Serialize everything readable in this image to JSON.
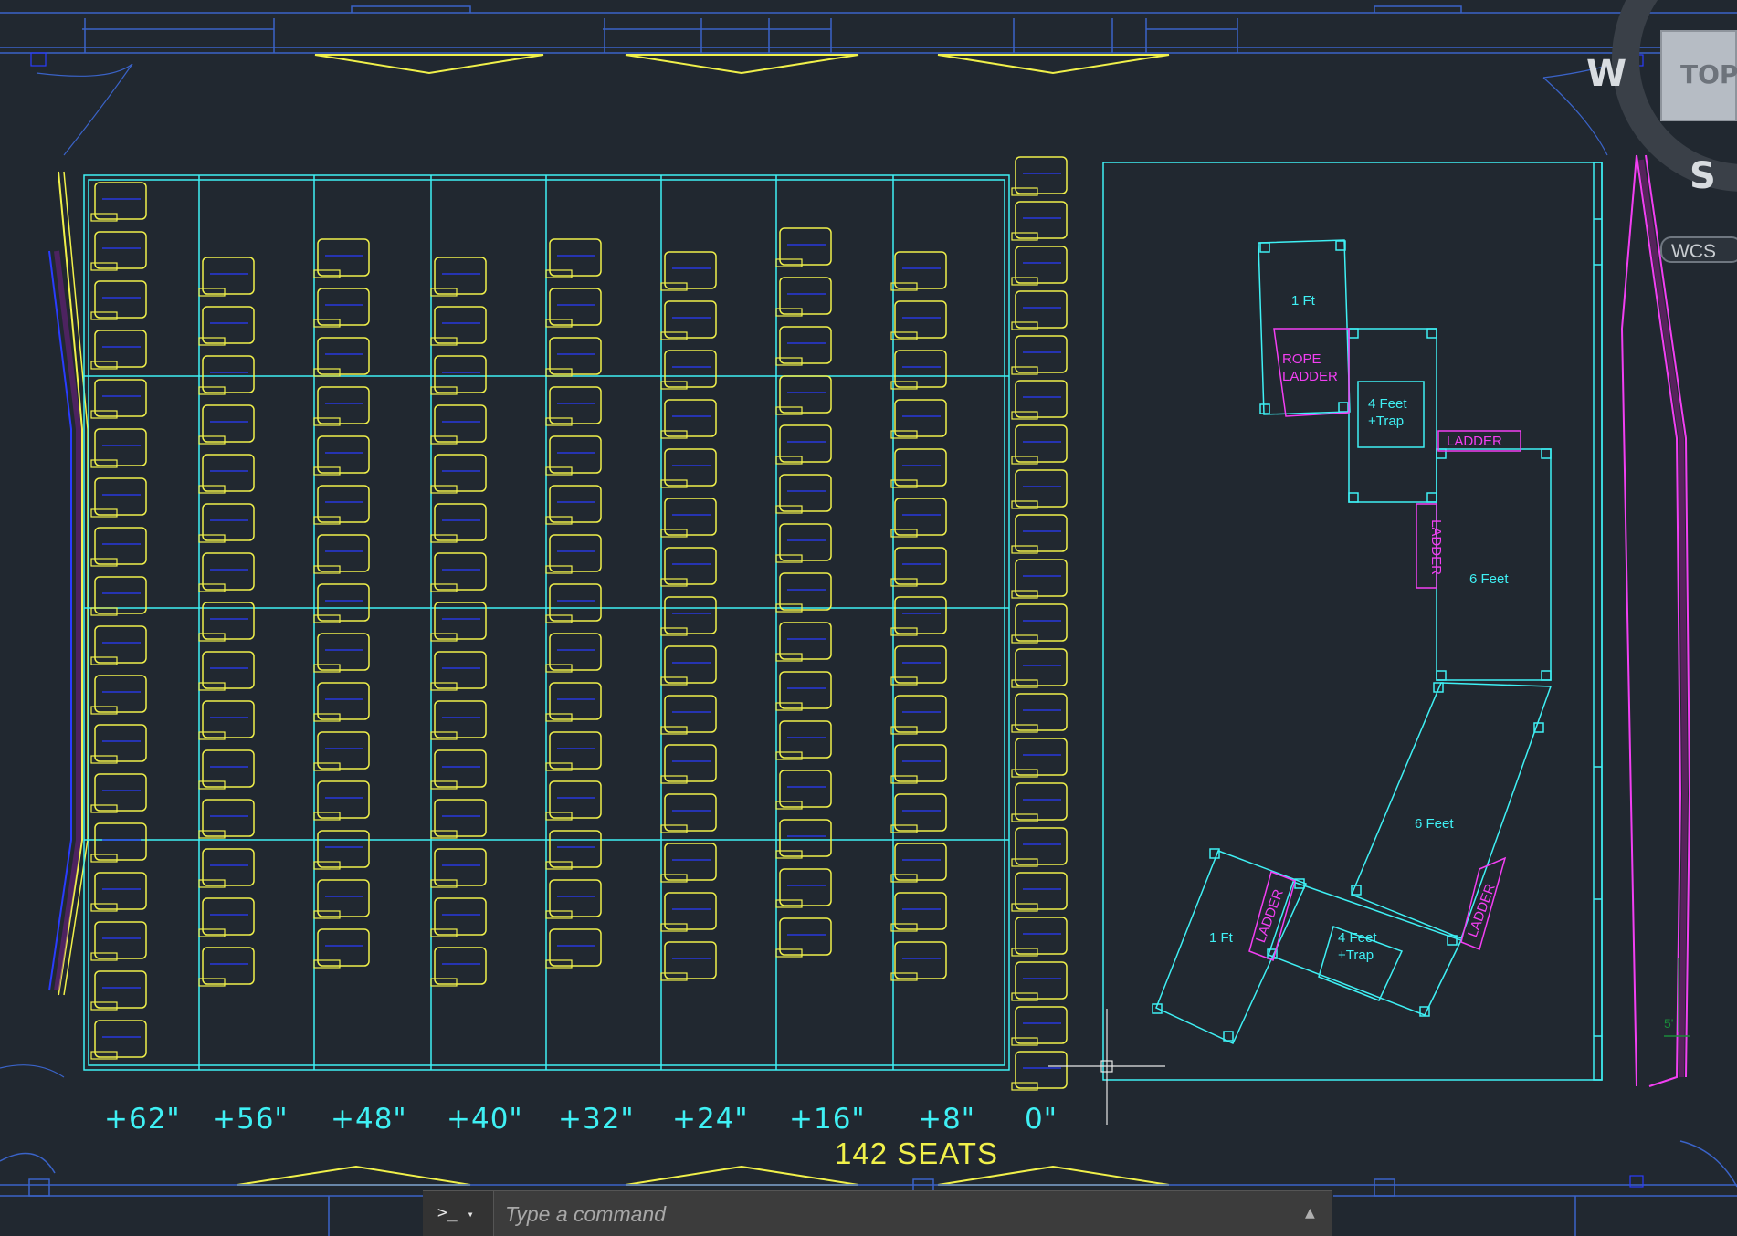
{
  "drawing": {
    "row_elevations": [
      "+62\"",
      "+56\"",
      "+48\"",
      "+40\"",
      "+32\"",
      "+24\"",
      "+16\"",
      "+8\"",
      "0\""
    ],
    "seat_total": "142 SEATS",
    "stage_labels": {
      "platform_1": "1 Ft",
      "rope_ladder": "ROPE\nLADDER",
      "trap_1": "4 Feet\n+Trap",
      "ladder_top": "LADDER",
      "ladder_side": "LADDER",
      "platform_6a": "6 Feet",
      "platform_6b": "6 Feet",
      "platform_1b": "1 Ft",
      "ladder_left": "LADDER",
      "trap_2": "4 Feet\n+Trap",
      "ladder_right": "LADDER"
    },
    "dimension_note": "5'"
  },
  "viewcube": {
    "face": "TOP",
    "west": "W",
    "south": "S",
    "coord_system": "WCS"
  },
  "command_line": {
    "prompt_icon": ">_",
    "placeholder": "Type a command"
  },
  "colors": {
    "background": "#212830",
    "cyan": "#3ff0f4",
    "yellow": "#f0f04a",
    "magenta": "#f23ff2",
    "blue": "#2a3cff"
  }
}
